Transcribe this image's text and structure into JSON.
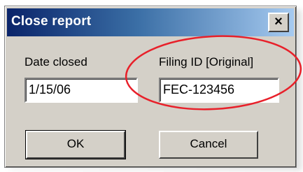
{
  "dialog": {
    "title": "Close report",
    "close_glyph": "×"
  },
  "fields": {
    "date_closed": {
      "label": "Date closed",
      "value": "1/15/06"
    },
    "filing_id": {
      "label": "Filing ID [Original]",
      "value": "FEC-123456"
    }
  },
  "buttons": {
    "ok": "OK",
    "cancel": "Cancel"
  },
  "annotation": {
    "color": "#e8202a",
    "shape": "ellipse-highlight"
  },
  "colors": {
    "title_bar_start": "#0a246a",
    "title_bar_end": "#a6caf0",
    "dialog_face": "#d4d0c8"
  }
}
